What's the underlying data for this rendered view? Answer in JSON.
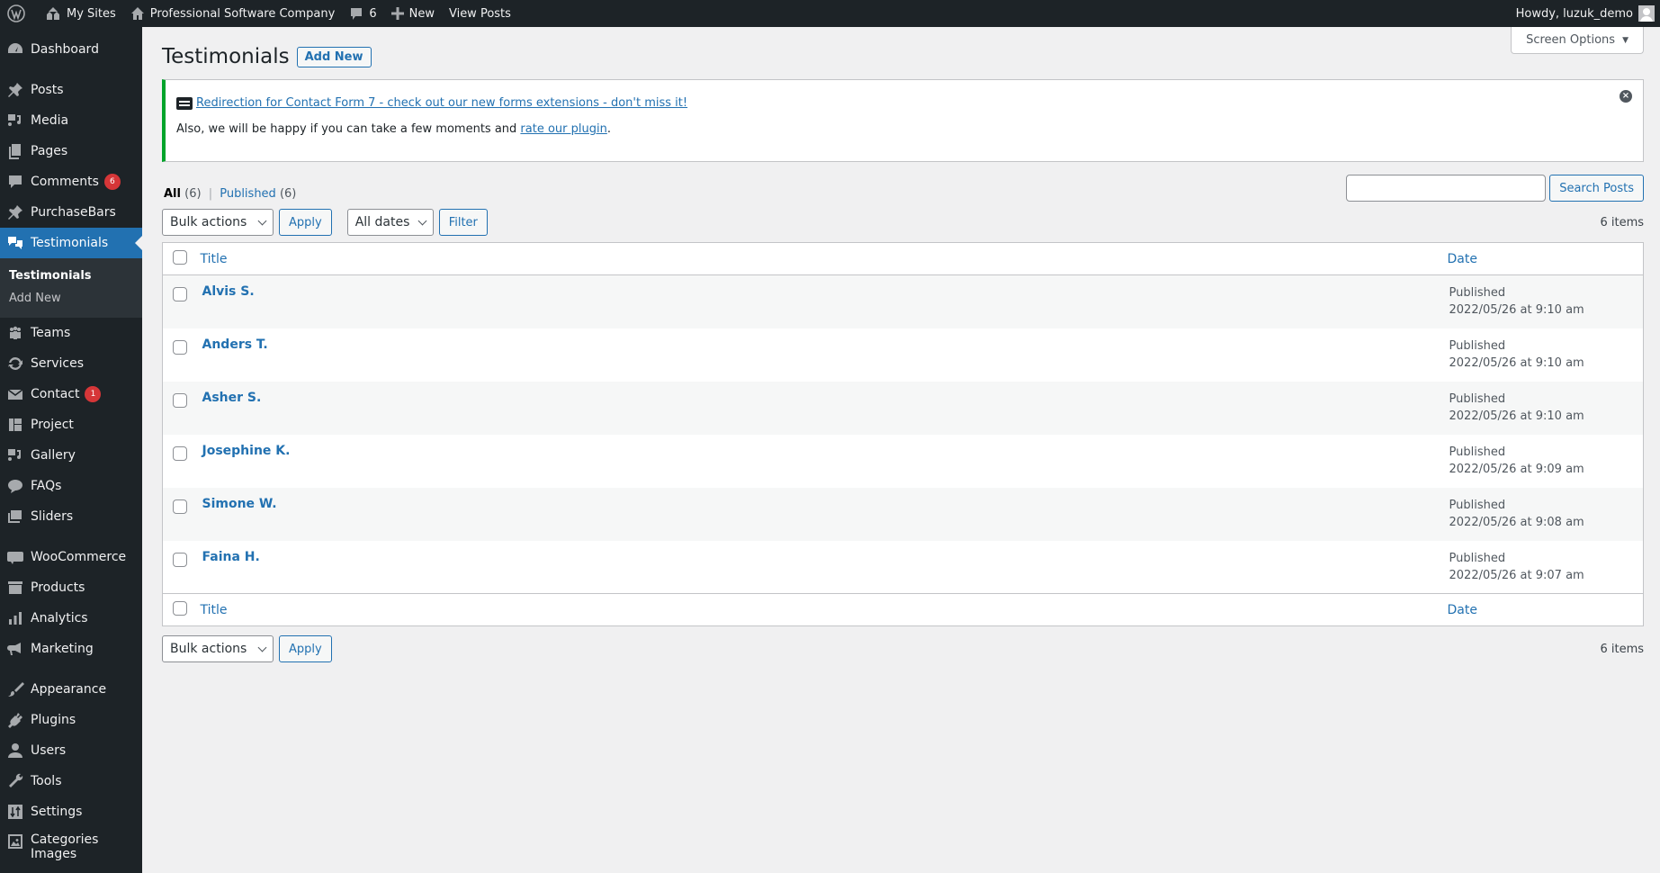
{
  "adminbar": {
    "my_sites": "My Sites",
    "site_name": "Professional Software Company",
    "comments_count": "6",
    "new_label": "New",
    "view_posts": "View Posts",
    "howdy": "Howdy, luzuk_demo"
  },
  "sidebar": {
    "items": [
      {
        "label": "Dashboard",
        "icon": "dashboard-icon"
      },
      {
        "label": "Posts",
        "icon": "pin-icon"
      },
      {
        "label": "Media",
        "icon": "media-icon"
      },
      {
        "label": "Pages",
        "icon": "pages-icon"
      },
      {
        "label": "Comments",
        "icon": "comment-icon",
        "badge": "6"
      },
      {
        "label": "PurchaseBars",
        "icon": "pin-icon"
      },
      {
        "label": "Testimonials",
        "icon": "testimonial-icon",
        "current": true
      },
      {
        "label": "Teams",
        "icon": "groups-icon"
      },
      {
        "label": "Services",
        "icon": "update-icon"
      },
      {
        "label": "Contact",
        "icon": "email-icon",
        "badge": "1"
      },
      {
        "label": "Project",
        "icon": "portfolio-icon"
      },
      {
        "label": "Gallery",
        "icon": "media-icon"
      },
      {
        "label": "FAQs",
        "icon": "chat-icon"
      },
      {
        "label": "Sliders",
        "icon": "images-icon"
      },
      {
        "label": "WooCommerce",
        "icon": "woo-icon"
      },
      {
        "label": "Products",
        "icon": "archive-icon"
      },
      {
        "label": "Analytics",
        "icon": "chart-bar-icon"
      },
      {
        "label": "Marketing",
        "icon": "megaphone-icon"
      },
      {
        "label": "Appearance",
        "icon": "brush-icon"
      },
      {
        "label": "Plugins",
        "icon": "plugin-icon"
      },
      {
        "label": "Users",
        "icon": "user-icon"
      },
      {
        "label": "Tools",
        "icon": "wrench-icon"
      },
      {
        "label": "Settings",
        "icon": "settings-icon"
      },
      {
        "label": "Categories Images",
        "icon": "format-image-icon"
      }
    ],
    "submenu": [
      {
        "label": "Testimonials",
        "current": true
      },
      {
        "label": "Add New"
      }
    ]
  },
  "screen_options": "Screen Options",
  "page": {
    "title": "Testimonials",
    "add_new": "Add New"
  },
  "notice": {
    "link_text": "Redirection for Contact Form 7 - check out our new forms extensions - don't miss it!",
    "text_before": "Also, we will be happy if you can take a few moments and ",
    "rate_link": "rate our plugin",
    "text_after": "."
  },
  "views": {
    "all_label": "All",
    "all_count": "(6)",
    "published_label": "Published",
    "published_count": "(6)"
  },
  "search": {
    "value": "",
    "button": "Search Posts"
  },
  "tablenav": {
    "bulk_actions": "Bulk actions",
    "apply": "Apply",
    "all_dates": "All dates",
    "filter": "Filter",
    "items_count": "6 items"
  },
  "table": {
    "columns": {
      "title": "Title",
      "date": "Date"
    },
    "rows": [
      {
        "title": "Alvis S.",
        "status": "Published",
        "date": "2022/05/26 at 9:10 am"
      },
      {
        "title": "Anders T.",
        "status": "Published",
        "date": "2022/05/26 at 9:10 am"
      },
      {
        "title": "Asher S.",
        "status": "Published",
        "date": "2022/05/26 at 9:10 am"
      },
      {
        "title": "Josephine K.",
        "status": "Published",
        "date": "2022/05/26 at 9:09 am"
      },
      {
        "title": "Simone W.",
        "status": "Published",
        "date": "2022/05/26 at 9:08 am"
      },
      {
        "title": "Faina H.",
        "status": "Published",
        "date": "2022/05/26 at 9:07 am"
      }
    ]
  },
  "colors": {
    "admin_dark": "#1d2327",
    "accent": "#2271b1",
    "badge": "#d63638",
    "notice_success": "#00a32a"
  }
}
